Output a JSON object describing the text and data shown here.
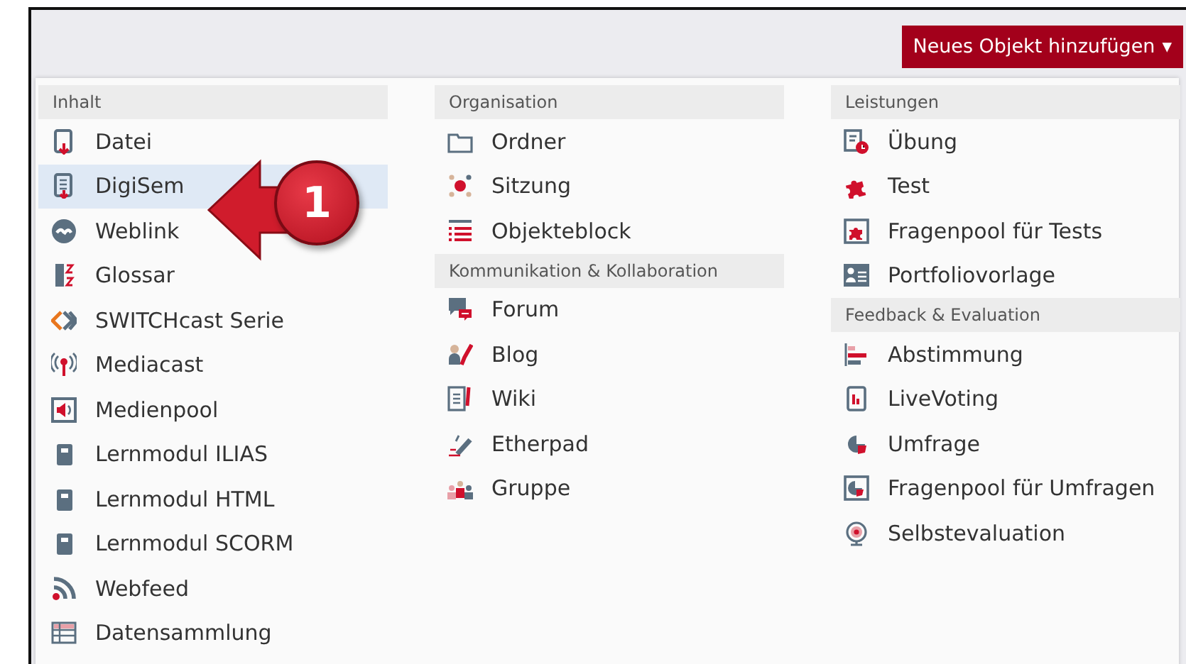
{
  "toolbar": {
    "add_button": {
      "label": "Neues Objekt hinzufügen",
      "caret": "▾"
    }
  },
  "columns": [
    {
      "groups": [
        {
          "title": "Inhalt",
          "items": [
            {
              "label": "Datei",
              "kind": "file",
              "selected": false
            },
            {
              "label": "DigiSem",
              "kind": "digisem",
              "selected": true
            },
            {
              "label": "Weblink",
              "kind": "weblink",
              "selected": false
            },
            {
              "label": "Glossar",
              "kind": "glossary",
              "selected": false
            },
            {
              "label": "SWITCHcast Serie",
              "kind": "switchcast",
              "selected": false
            },
            {
              "label": "Mediacast",
              "kind": "mediacast",
              "selected": false
            },
            {
              "label": "Medienpool",
              "kind": "mediapool",
              "selected": false
            },
            {
              "label": "Lernmodul ILIAS",
              "kind": "module",
              "selected": false
            },
            {
              "label": "Lernmodul HTML",
              "kind": "module",
              "selected": false
            },
            {
              "label": "Lernmodul SCORM",
              "kind": "module",
              "selected": false
            },
            {
              "label": "Webfeed",
              "kind": "feed",
              "selected": false
            },
            {
              "label": "Datensammlung",
              "kind": "data",
              "selected": false
            }
          ]
        }
      ]
    },
    {
      "groups": [
        {
          "title": "Organisation",
          "items": [
            {
              "label": "Ordner",
              "kind": "folder",
              "selected": false
            },
            {
              "label": "Sitzung",
              "kind": "session",
              "selected": false
            },
            {
              "label": "Objekteblock",
              "kind": "block",
              "selected": false
            }
          ]
        },
        {
          "title": "Kommunikation & Kollaboration",
          "items": [
            {
              "label": "Forum",
              "kind": "forum",
              "selected": false
            },
            {
              "label": "Blog",
              "kind": "blog",
              "selected": false
            },
            {
              "label": "Wiki",
              "kind": "wiki",
              "selected": false
            },
            {
              "label": "Etherpad",
              "kind": "etherpad",
              "selected": false
            },
            {
              "label": "Gruppe",
              "kind": "group",
              "selected": false
            }
          ]
        }
      ]
    },
    {
      "groups": [
        {
          "title": "Leistungen",
          "items": [
            {
              "label": "Übung",
              "kind": "exercise",
              "selected": false
            },
            {
              "label": "Test",
              "kind": "test",
              "selected": false
            },
            {
              "label": "Fragenpool für Tests",
              "kind": "testpool",
              "selected": false
            },
            {
              "label": "Portfoliovorlage",
              "kind": "portfolio",
              "selected": false
            }
          ]
        },
        {
          "title": "Feedback & Evaluation",
          "items": [
            {
              "label": "Abstimmung",
              "kind": "poll",
              "selected": false
            },
            {
              "label": "LiveVoting",
              "kind": "voting",
              "selected": false
            },
            {
              "label": "Umfrage",
              "kind": "survey",
              "selected": false
            },
            {
              "label": "Fragenpool für Umfragen",
              "kind": "surveypool",
              "selected": false
            },
            {
              "label": "Selbstevaluation",
              "kind": "selfeval",
              "selected": false
            }
          ]
        }
      ]
    }
  ],
  "callout": {
    "number": "1"
  }
}
